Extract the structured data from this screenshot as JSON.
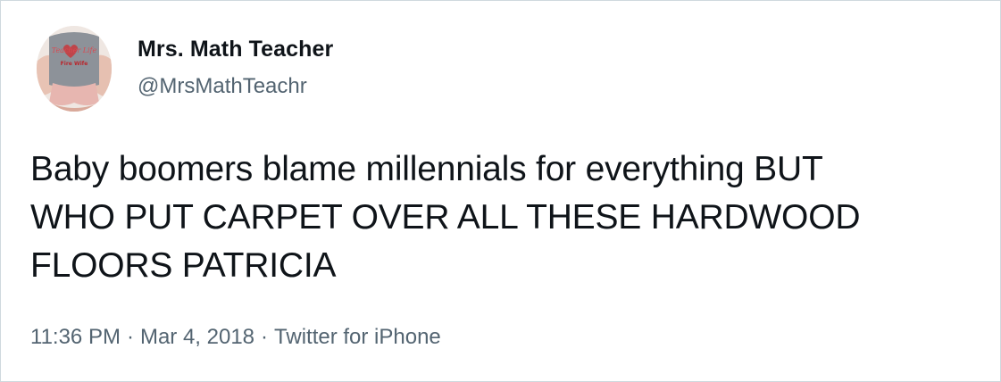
{
  "tweet": {
    "author": {
      "display_name": "Mrs. Math Teacher",
      "handle": "@MrsMathTeachr",
      "avatar_shirt_text": [
        "Teacher Life",
        "Fire Wife"
      ]
    },
    "text_lines": [
      "Baby boomers blame millennials for everything BUT",
      "WHO PUT CARPET OVER ALL THESE HARDWOOD",
      "FLOORS PATRICIA"
    ],
    "meta": {
      "time": "11:36 PM",
      "separator": "·",
      "date": "Mar 4, 2018",
      "source": "Twitter for iPhone"
    }
  },
  "colors": {
    "border": "#cfd9de",
    "text_primary": "#0f1419",
    "text_secondary": "#536471"
  }
}
